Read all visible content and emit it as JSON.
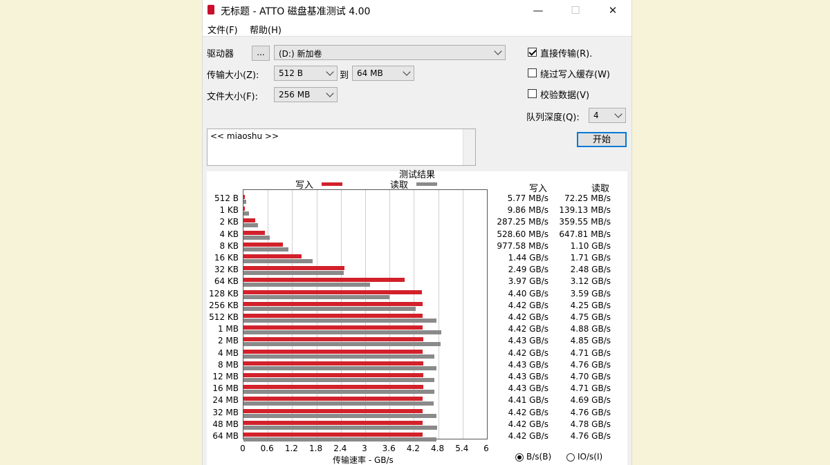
{
  "window": {
    "title": "无标题 - ATTO 磁盘基准测试 4.00",
    "minimize": "—",
    "maximize": "☐",
    "close": "✕"
  },
  "menu": {
    "file": "文件(F)",
    "help": "帮助(H)"
  },
  "settings": {
    "drive_label": "驱动器",
    "browse_label": "...",
    "drive_value": "(D:) 新加卷",
    "transfer_label": "传输大小(Z):",
    "transfer_from": "512 B",
    "to_label": "到",
    "transfer_to": "64 MB",
    "filesize_label": "文件大小(F):",
    "filesize_value": "256 MB",
    "direct_io_label": "直接传输(R).",
    "direct_io_checked": true,
    "bypass_cache_label": "绕过写入缓存(W)",
    "bypass_cache_checked": false,
    "verify_label": "校验数据(V)",
    "verify_checked": false,
    "queue_label": "队列深度(Q):",
    "queue_value": "4",
    "start_label": "开始"
  },
  "description": {
    "text": "<< miaoshu >>"
  },
  "results": {
    "title": "测试结果",
    "legend_write": "写入",
    "legend_read": "读取",
    "col_write": "写入",
    "col_read": "读取",
    "write_color": "#d2212b",
    "read_color": "#8a8a8a",
    "units_bytes": "B/s(B)",
    "units_io": "IO/s(I)",
    "units_selected": "bytes",
    "rows": [
      {
        "size": "512 B",
        "write": "5.77 MB/s",
        "read": "72.25 MB/s"
      },
      {
        "size": "1 KB",
        "write": "9.86 MB/s",
        "read": "139.13 MB/s"
      },
      {
        "size": "2 KB",
        "write": "287.25 MB/s",
        "read": "359.55 MB/s"
      },
      {
        "size": "4 KB",
        "write": "528.60 MB/s",
        "read": "647.81 MB/s"
      },
      {
        "size": "8 KB",
        "write": "977.58 MB/s",
        "read": "1.10 GB/s"
      },
      {
        "size": "16 KB",
        "write": "1.44 GB/s",
        "read": "1.71 GB/s"
      },
      {
        "size": "32 KB",
        "write": "2.49 GB/s",
        "read": "2.48 GB/s"
      },
      {
        "size": "64 KB",
        "write": "3.97 GB/s",
        "read": "3.12 GB/s"
      },
      {
        "size": "128 KB",
        "write": "4.40 GB/s",
        "read": "3.59 GB/s"
      },
      {
        "size": "256 KB",
        "write": "4.42 GB/s",
        "read": "4.25 GB/s"
      },
      {
        "size": "512 KB",
        "write": "4.42 GB/s",
        "read": "4.75 GB/s"
      },
      {
        "size": "1 MB",
        "write": "4.42 GB/s",
        "read": "4.88 GB/s"
      },
      {
        "size": "2 MB",
        "write": "4.43 GB/s",
        "read": "4.85 GB/s"
      },
      {
        "size": "4 MB",
        "write": "4.42 GB/s",
        "read": "4.71 GB/s"
      },
      {
        "size": "8 MB",
        "write": "4.43 GB/s",
        "read": "4.76 GB/s"
      },
      {
        "size": "12 MB",
        "write": "4.43 GB/s",
        "read": "4.70 GB/s"
      },
      {
        "size": "16 MB",
        "write": "4.43 GB/s",
        "read": "4.71 GB/s"
      },
      {
        "size": "24 MB",
        "write": "4.41 GB/s",
        "read": "4.69 GB/s"
      },
      {
        "size": "32 MB",
        "write": "4.42 GB/s",
        "read": "4.76 GB/s"
      },
      {
        "size": "48 MB",
        "write": "4.42 GB/s",
        "read": "4.78 GB/s"
      },
      {
        "size": "64 MB",
        "write": "4.42 GB/s",
        "read": "4.76 GB/s"
      }
    ]
  },
  "chart_data": {
    "type": "bar",
    "orientation": "horizontal",
    "title": "测试结果",
    "xlabel": "传输速率 - GB/s",
    "xlim": [
      0,
      6
    ],
    "xticks": [
      "0",
      "0.6",
      "1.2",
      "1.8",
      "2.4",
      "3",
      "3.6",
      "4.2",
      "4.8",
      "5.4",
      "6"
    ],
    "grid": true,
    "legend": "top",
    "categories": [
      "512 B",
      "1 KB",
      "2 KB",
      "4 KB",
      "8 KB",
      "16 KB",
      "32 KB",
      "64 KB",
      "128 KB",
      "256 KB",
      "512 KB",
      "1 MB",
      "2 MB",
      "4 MB",
      "8 MB",
      "12 MB",
      "16 MB",
      "24 MB",
      "32 MB",
      "48 MB",
      "64 MB"
    ],
    "series": [
      {
        "name": "写入",
        "color": "#d2212b",
        "values": [
          0.00577,
          0.00986,
          0.28725,
          0.5286,
          0.97758,
          1.44,
          2.49,
          3.97,
          4.4,
          4.42,
          4.42,
          4.42,
          4.43,
          4.42,
          4.43,
          4.43,
          4.43,
          4.41,
          4.42,
          4.42,
          4.42
        ]
      },
      {
        "name": "读取",
        "color": "#8a8a8a",
        "values": [
          0.07225,
          0.13913,
          0.35955,
          0.64781,
          1.1,
          1.71,
          2.48,
          3.12,
          3.59,
          4.25,
          4.75,
          4.88,
          4.85,
          4.71,
          4.76,
          4.7,
          4.71,
          4.69,
          4.76,
          4.78,
          4.76
        ]
      }
    ]
  }
}
